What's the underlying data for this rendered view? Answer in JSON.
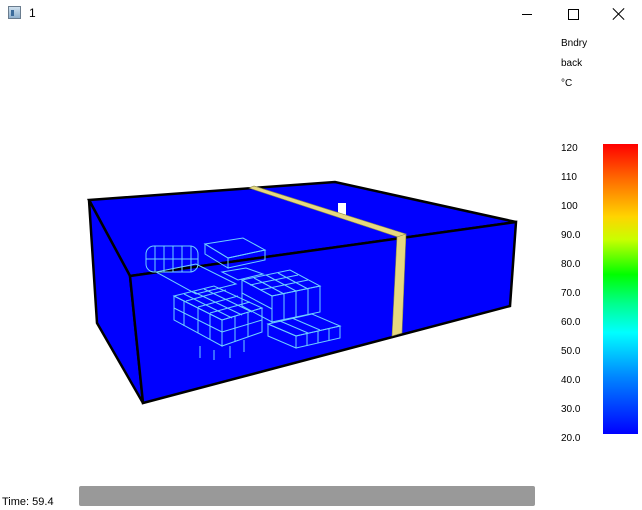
{
  "window": {
    "title": "1"
  },
  "labels": {
    "line1": "Bndry",
    "line2": "back",
    "line3": "°C"
  },
  "colorbar": {
    "ticks": [
      "120",
      "110",
      "100",
      "90.0",
      "80.0",
      "70.0",
      "60.0",
      "50.0",
      "40.0",
      "30.0",
      "20.0"
    ],
    "colors": {
      "max": "#ff0000",
      "min": "#0000ff"
    }
  },
  "footer": {
    "time_label": "Time: 59.4"
  },
  "colors": {
    "domain": "#0000ff",
    "panel": "#e6d880",
    "mesh": "#6fd0ff"
  }
}
